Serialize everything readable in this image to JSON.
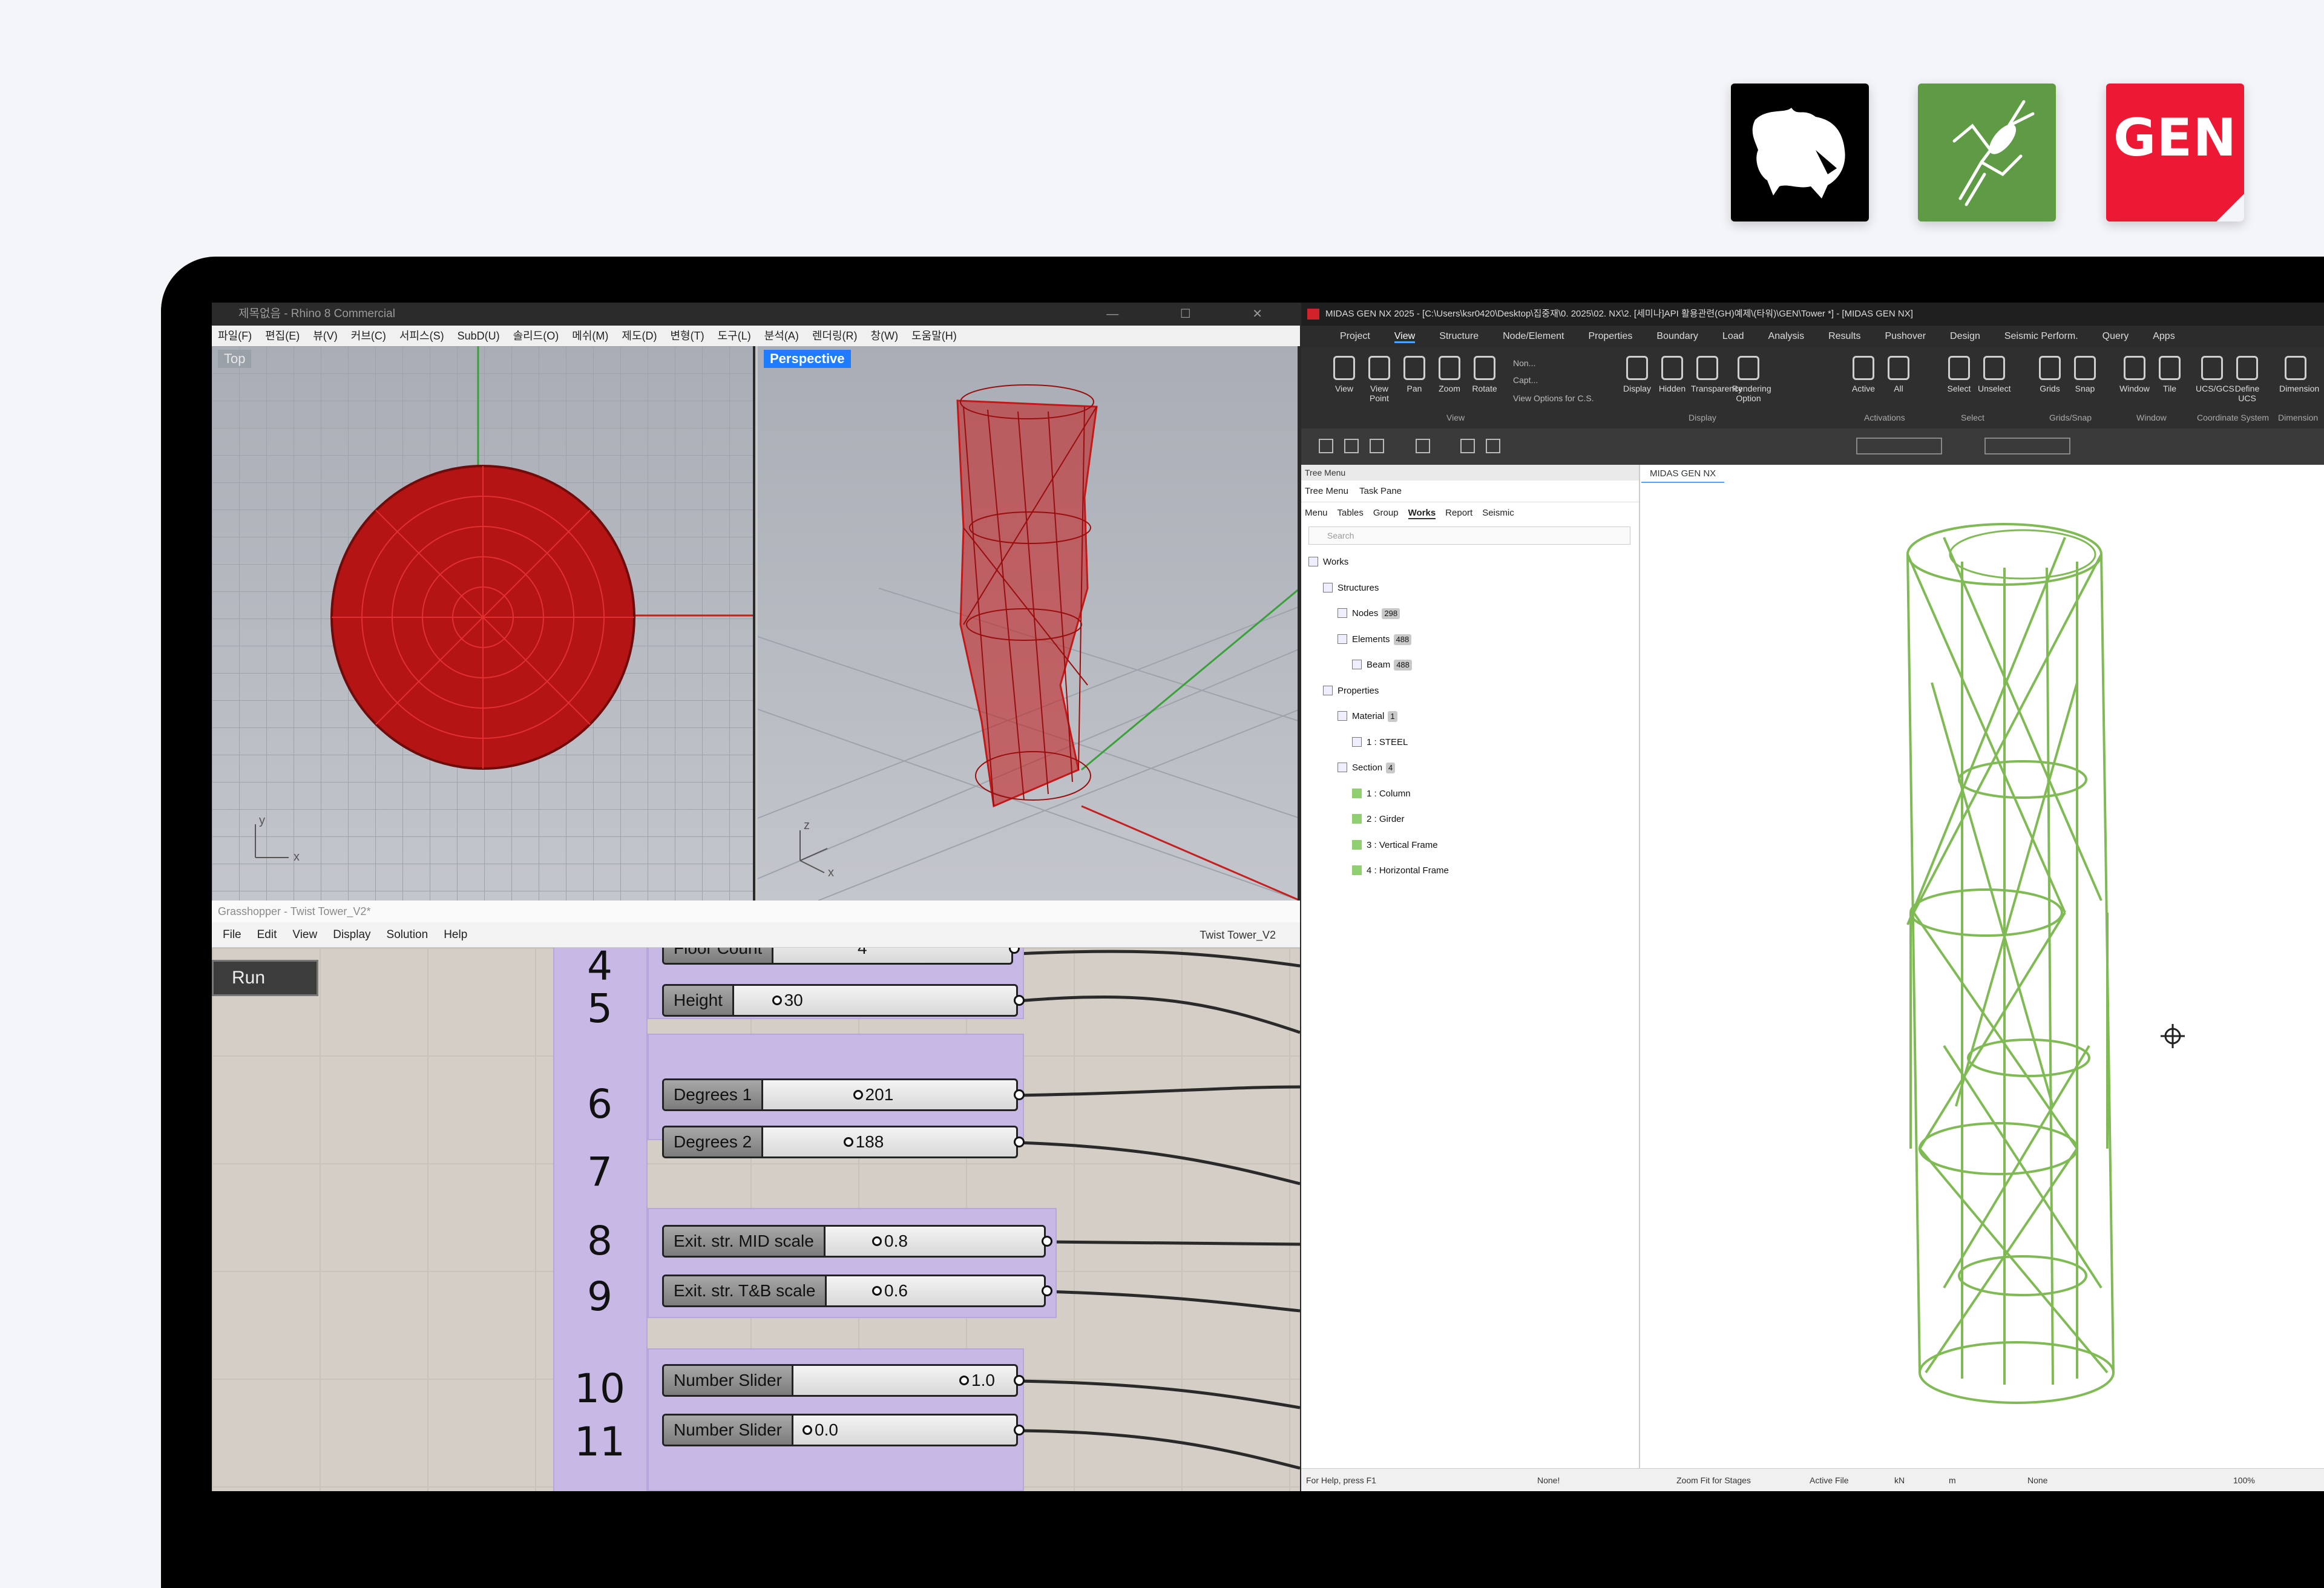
{
  "logos": {
    "rhino": "rhino-logo-icon",
    "grasshopper": "grasshopper-logo-icon",
    "gen": "GEN"
  },
  "rhino": {
    "title": "제목없음 - Rhino 8 Commercial",
    "menu": [
      "파일(F)",
      "편집(E)",
      "뷰(V)",
      "커브(C)",
      "서피스(S)",
      "SubD(U)",
      "솔리드(O)",
      "메쉬(M)",
      "제도(D)",
      "변형(T)",
      "도구(L)",
      "분석(A)",
      "렌더링(R)",
      "창(W)",
      "도움말(H)"
    ],
    "viewport_top": "Top",
    "viewport_perspective": "Perspective",
    "axis_x": "x",
    "axis_y": "y",
    "axis_z": "z"
  },
  "grasshopper": {
    "title": "Grasshopper - Twist Tower_V2*",
    "menu": [
      "File",
      "Edit",
      "View",
      "Display",
      "Solution",
      "Help"
    ],
    "doc_name": "Twist Tower_V2",
    "run_label": "Run",
    "partial_label": "Floor Count",
    "partial_value": "4",
    "numbers": [
      "4",
      "5",
      "6",
      "7",
      "8",
      "9",
      "10",
      "11"
    ],
    "sliders": [
      {
        "label": "Height",
        "value": "30",
        "fraction": 0.15
      },
      {
        "label": "Degrees 1",
        "value": "201",
        "fraction": 0.45
      },
      {
        "label": "Degrees 2",
        "value": "188",
        "fraction": 0.4
      },
      {
        "label": "Exit. str. MID scale",
        "value": "0.8",
        "fraction": 0.05
      },
      {
        "label": "Exit. str. T&B scale",
        "value": "0.6",
        "fraction": 0.05
      },
      {
        "label": "Number Slider",
        "value": "1.0",
        "fraction": 1.0
      },
      {
        "label": "Number Slider",
        "value": "0.0",
        "fraction": 0.0
      }
    ]
  },
  "midas": {
    "title": "MIDAS GEN NX 2025 - [C:\\Users\\ksr0420\\Desktop\\집중재\\0. 2025\\02. NX\\2. [세미나]API 활용관련(GH)예제\\(타워)\\GEN\\Tower *] - [MIDAS GEN NX]",
    "tabs": [
      "Project",
      "View",
      "Structure",
      "Node/Element",
      "Properties",
      "Boundary",
      "Load",
      "Analysis",
      "Results",
      "Pushover",
      "Design",
      "Seismic Perform.",
      "Query",
      "Apps"
    ],
    "active_tab": "View",
    "ribbon": [
      {
        "label": "View"
      },
      {
        "label": "View Point"
      },
      {
        "label": "Pan"
      },
      {
        "label": "Zoom"
      },
      {
        "label": "Rotate"
      },
      {
        "label": "Display"
      },
      {
        "label": "Hidden"
      },
      {
        "label": "Transparency"
      },
      {
        "label": "Rendering Option"
      },
      {
        "label": "Active"
      },
      {
        "label": "All"
      },
      {
        "label": "Select"
      },
      {
        "label": "Unselect"
      },
      {
        "label": "Grids"
      },
      {
        "label": "Snap"
      },
      {
        "label": "Window"
      },
      {
        "label": "Tile"
      },
      {
        "label": "UCS/GCS"
      },
      {
        "label": "Define UCS"
      },
      {
        "label": "Dimension"
      }
    ],
    "ribbon_small": [
      "Non...",
      "Capt...",
      "View Options for C.S."
    ],
    "ribbon_groups": [
      "View",
      "Display",
      "Activations",
      "Select",
      "Grids/Snap",
      "Window",
      "Coordinate System",
      "Dimension"
    ],
    "tree": {
      "header": "Tree Menu",
      "tabs": [
        "Tree Menu",
        "Task Pane"
      ],
      "subtabs": [
        "Menu",
        "Tables",
        "Group",
        "Works",
        "Report",
        "Seismic"
      ],
      "active_subtab": "Works",
      "search_placeholder": "Search",
      "items": [
        {
          "label": "Works",
          "badge": ""
        },
        {
          "label": "Structures",
          "badge": ""
        },
        {
          "label": "Nodes",
          "badge": "298"
        },
        {
          "label": "Elements",
          "badge": "488"
        },
        {
          "label": "Beam",
          "badge": "488"
        },
        {
          "label": "Properties",
          "badge": ""
        },
        {
          "label": "Material",
          "badge": "1"
        },
        {
          "label": "1 : STEEL",
          "badge": ""
        },
        {
          "label": "Section",
          "badge": "4"
        },
        {
          "label": "1 : Column",
          "badge": ""
        },
        {
          "label": "2 : Girder",
          "badge": ""
        },
        {
          "label": "3 : Vertical Frame",
          "badge": ""
        },
        {
          "label": "4 : Horizontal Frame",
          "badge": ""
        }
      ]
    },
    "view_tab": "MIDAS GEN NX",
    "status": {
      "help": "For Help, press F1",
      "none": "None!",
      "zoom_fit": "Zoom Fit for Stages",
      "active_file": "Active File",
      "force_unit": "kN",
      "length_unit": "m",
      "select": "None",
      "zoom": "100%"
    },
    "colors": {
      "model": "#8bc45e",
      "accent": "#4aa3ff"
    }
  }
}
